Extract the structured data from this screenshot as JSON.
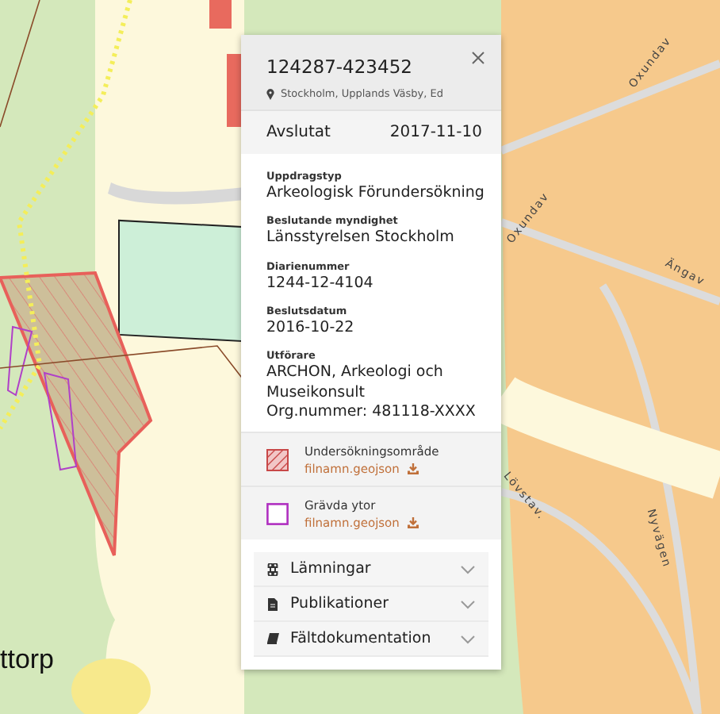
{
  "map": {
    "labels": [
      {
        "text": "ttorp"
      },
      {
        "text": "Oxundav"
      },
      {
        "text": "Oxundav"
      },
      {
        "text": "Ängav"
      },
      {
        "text": "Lövstav."
      },
      {
        "text": "Nyvägen"
      }
    ]
  },
  "popup": {
    "title": "124287-423452",
    "location": "Stockholm, Upplands Väsby, Ed",
    "status": "Avslutat",
    "date": "2017-11-10",
    "fields": [
      {
        "label": "Uppdragstyp",
        "lines": [
          "Arkeologisk Förundersökning"
        ]
      },
      {
        "label": "Beslutande myndighet",
        "lines": [
          "Länsstyrelsen Stockholm"
        ]
      },
      {
        "label": "Diarienummer",
        "lines": [
          "1244-12-4104"
        ]
      },
      {
        "label": "Beslutsdatum",
        "lines": [
          "2016-10-22"
        ]
      },
      {
        "label": "Utförare",
        "lines": [
          "ARCHON, Arkeologi och Museikonsult",
          "Org.nummer: 481118-XXXX"
        ]
      }
    ],
    "layers": [
      {
        "kind": "hatched",
        "name": "Undersökningsområde",
        "file": "filnamn.geojson"
      },
      {
        "kind": "outline",
        "name": "Grävda ytor",
        "file": "filnamn.geojson"
      }
    ],
    "sections": [
      {
        "kind": "remains",
        "label": "Lämningar",
        "expanded": false
      },
      {
        "kind": "publications",
        "label": "Publikationer",
        "expanded": false
      },
      {
        "kind": "fieldwork",
        "label": "Fältdokumentation",
        "expanded": false
      }
    ]
  }
}
